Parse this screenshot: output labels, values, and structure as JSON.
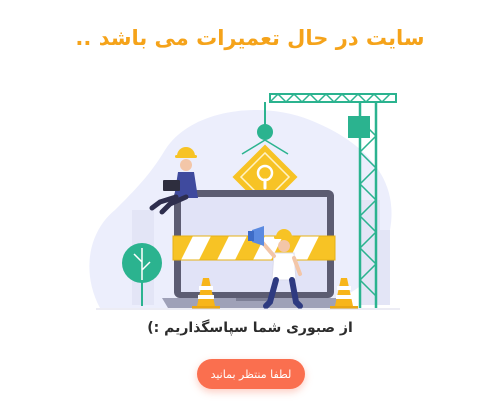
{
  "page": {
    "title": "سایت در حال تعمیرات می باشد ..",
    "subtitle": "از صبوری شما سپاسگذاریم :)",
    "button_label": "لطفا منتظر بمانید"
  },
  "colors": {
    "title": "#f5a31a",
    "button": "#fa6f4f",
    "crane": "#2bb38f",
    "warning_sign": "#f7c325",
    "blob": "#eceefc"
  },
  "illustration": {
    "icons": [
      "crane-icon",
      "warning-sign-icon",
      "laptop-icon",
      "barrier-icon",
      "worker-icon",
      "megaphone-icon",
      "traffic-cone-icon",
      "tree-icon"
    ]
  }
}
